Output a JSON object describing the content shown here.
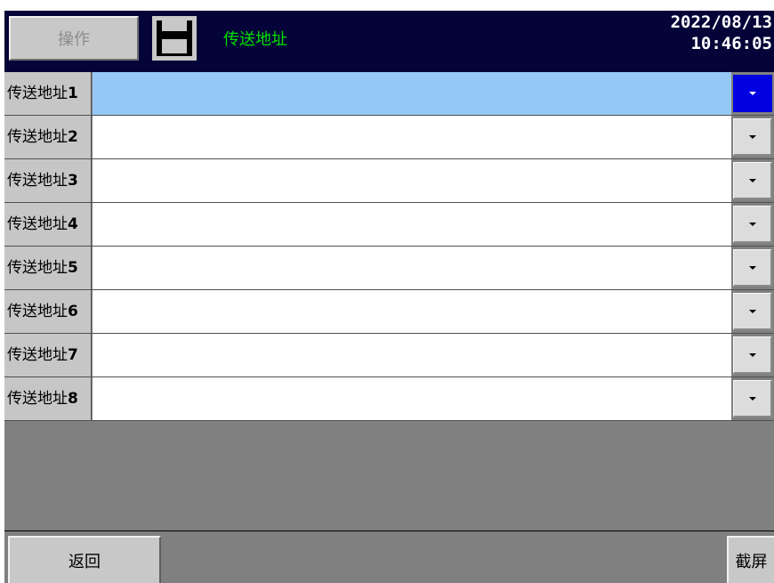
{
  "header": {
    "operation_label": "操作",
    "title": "传送地址",
    "date": "2022/08/13",
    "time": "10:46:05"
  },
  "rows": [
    {
      "label": "传送地址",
      "num": "1",
      "value": "",
      "selected": true
    },
    {
      "label": "传送地址",
      "num": "2",
      "value": ""
    },
    {
      "label": "传送地址",
      "num": "3",
      "value": ""
    },
    {
      "label": "传送地址",
      "num": "4",
      "value": ""
    },
    {
      "label": "传送地址",
      "num": "5",
      "value": ""
    },
    {
      "label": "传送地址",
      "num": "6",
      "value": ""
    },
    {
      "label": "传送地址",
      "num": "7",
      "value": ""
    },
    {
      "label": "传送地址",
      "num": "8",
      "value": ""
    }
  ],
  "footer": {
    "back_label": "返回",
    "screenshot_label": "截屏"
  }
}
